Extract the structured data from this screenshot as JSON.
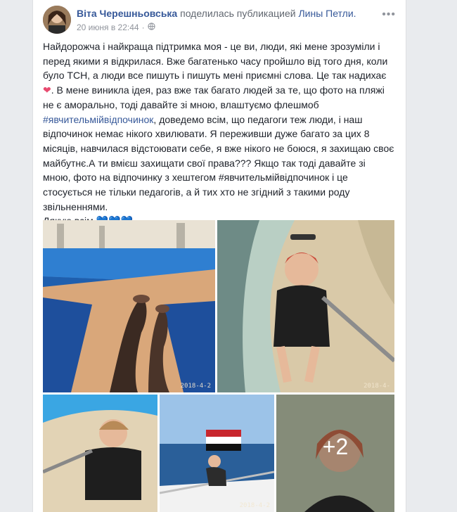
{
  "post": {
    "author": "Віта Черешньовська",
    "shared_text": "поделилась публикацией",
    "shared_from": "Лины Петли.",
    "timestamp": "20 июня в 22:44",
    "more_icon": "ellipsis-icon",
    "privacy_icon": "globe-icon"
  },
  "body": {
    "part1": "Найдорожча і найкраща підтримка моя - це ви, люди, які мене зрозуміли і перед якими я відкрилася. Вже багатенько часу пройшло від того дня, коли було ТСН, а люди все пишуть і пишуть мені приємні слова. Це так надихає",
    "heart": "❤",
    "part2": ". В мене виникла ідея, раз вже так багато людей за те, що фото на пляжі не є аморально, тоді давайте зі мною, влаштуємо флешмоб",
    "hashtag1": "#явчительмійвідпочинок",
    "part3": ", доведемо всім, що педагоги теж люди, і наш відпочинок немає нікого хвилювати. Я переживши дуже багато за цих 8 місяців, навчилася відстоювати себе, я вже нікого не боюся, я захищаю своє майбутнє.А ти вмієш захищати свої права??? Якщо так тоді давайте зі мною, фото на відпочинку з хештегом #явчительмійвідпочинок і це стосується не тільки педагогів, а й тих хто не згідний з такими роду звільненнями.",
    "thanks": "Дякую всім",
    "blue_hearts": "💙💙💙"
  },
  "photos": {
    "stamp1": "2018-4-2",
    "stamp2": "2018-4-",
    "stamp4": "2018-4-2",
    "more_count": "+2"
  }
}
